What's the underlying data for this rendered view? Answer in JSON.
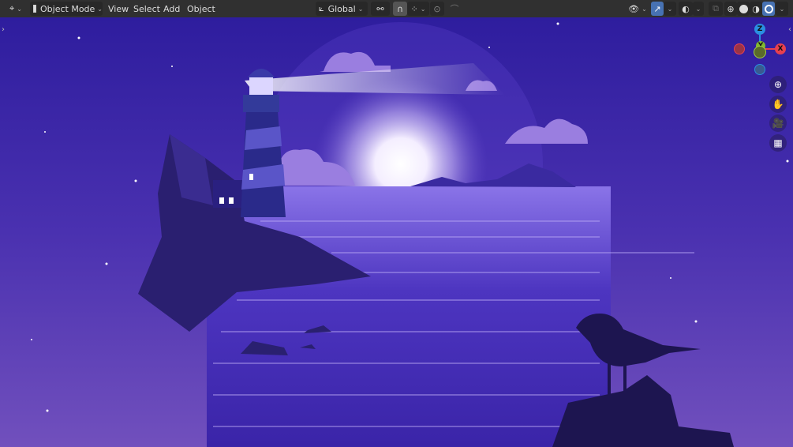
{
  "header": {
    "editor_type_icon": "3d-viewport-icon",
    "mode": "Object Mode",
    "menus": [
      "View",
      "Select",
      "Add",
      "Object"
    ],
    "transform_orientation": "Global",
    "pivot_icon": "pivot-icon",
    "snap_icon": "magnet-icon",
    "snap_target_icon": "snap-grid-icon",
    "proportional_icon": "proportional-edit-icon",
    "falloff_icon": "falloff-curve-icon",
    "visibility_icon": "visibility-icon",
    "gizmo_icon": "gizmo-icon",
    "overlay_icon": "overlay-icon",
    "xray_icon": "xray-icon",
    "shading_modes": [
      "wireframe",
      "solid",
      "material-preview",
      "rendered"
    ],
    "active_shading": "rendered"
  },
  "gizmo": {
    "axes": [
      "Z",
      "Y",
      "X"
    ],
    "colors": {
      "x": "#e8404e",
      "y": "#80b830",
      "z": "#2a8fe0"
    }
  },
  "nav_buttons": [
    "zoom",
    "pan",
    "camera",
    "ortho-grid"
  ]
}
